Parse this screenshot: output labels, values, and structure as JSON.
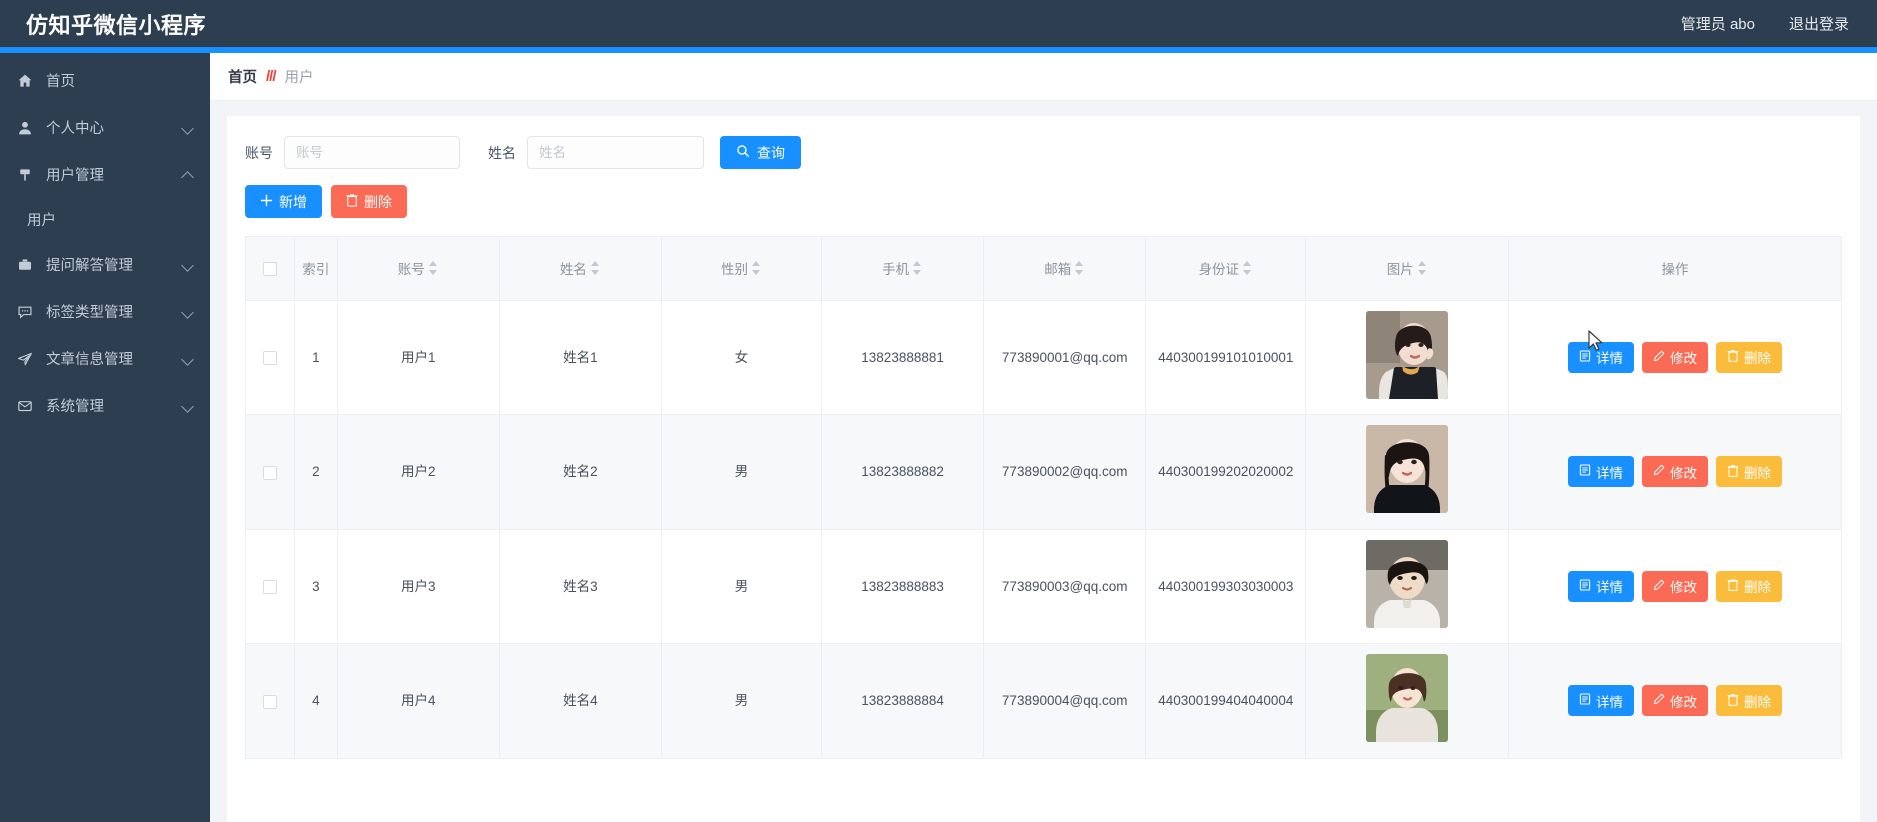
{
  "topbar": {
    "brand": "仿知乎微信小程序",
    "admin_label": "管理员 abo",
    "logout_label": "退出登录"
  },
  "sidebar": {
    "items": [
      {
        "label": "首页",
        "icon": "home-icon",
        "caret": "none",
        "expanded": false
      },
      {
        "label": "个人中心",
        "icon": "user-icon",
        "caret": "down",
        "expanded": false
      },
      {
        "label": "用户管理",
        "icon": "pin-icon",
        "caret": "up",
        "expanded": true
      },
      {
        "label": "提问解答管理",
        "icon": "briefcase-icon",
        "caret": "down",
        "expanded": false
      },
      {
        "label": "标签类型管理",
        "icon": "comment-icon",
        "caret": "down",
        "expanded": false
      },
      {
        "label": "文章信息管理",
        "icon": "send-icon",
        "caret": "down",
        "expanded": false
      },
      {
        "label": "系统管理",
        "icon": "mail-icon",
        "caret": "down",
        "expanded": false
      }
    ],
    "submenu": {
      "parent": "用户管理",
      "items": [
        {
          "label": "用户"
        }
      ]
    }
  },
  "breadcrumb": {
    "home": "首页",
    "separator": "///",
    "current": "用户"
  },
  "search": {
    "account_label": "账号",
    "account_placeholder": "账号",
    "account_value": "",
    "name_label": "姓名",
    "name_placeholder": "姓名",
    "name_value": "",
    "query_button": "查询",
    "query_icon": "search-icon"
  },
  "toolbar": {
    "add_label": "新增",
    "add_icon": "plus-icon",
    "delete_label": "删除",
    "delete_icon": "trash-icon"
  },
  "table": {
    "columns": [
      {
        "key": "checkbox",
        "label": "",
        "sortable": false
      },
      {
        "key": "index",
        "label": "索引",
        "sortable": false
      },
      {
        "key": "account",
        "label": "账号",
        "sortable": true
      },
      {
        "key": "name",
        "label": "姓名",
        "sortable": true
      },
      {
        "key": "gender",
        "label": "性别",
        "sortable": true
      },
      {
        "key": "phone",
        "label": "手机",
        "sortable": true
      },
      {
        "key": "email",
        "label": "邮箱",
        "sortable": true
      },
      {
        "key": "idcard",
        "label": "身份证",
        "sortable": true
      },
      {
        "key": "image",
        "label": "图片",
        "sortable": true
      },
      {
        "key": "ops",
        "label": "操作",
        "sortable": false
      }
    ],
    "rows": [
      {
        "index": "1",
        "account": "用户1",
        "name": "姓名1",
        "gender": "女",
        "phone": "13823888881",
        "email": "773890001@qq.com",
        "idcard": "440300199101010001",
        "image_alt": "avatar-1"
      },
      {
        "index": "2",
        "account": "用户2",
        "name": "姓名2",
        "gender": "男",
        "phone": "13823888882",
        "email": "773890002@qq.com",
        "idcard": "440300199202020002",
        "image_alt": "avatar-2"
      },
      {
        "index": "3",
        "account": "用户3",
        "name": "姓名3",
        "gender": "男",
        "phone": "13823888883",
        "email": "773890003@qq.com",
        "idcard": "440300199303030003",
        "image_alt": "avatar-3"
      },
      {
        "index": "4",
        "account": "用户4",
        "name": "姓名4",
        "gender": "男",
        "phone": "13823888884",
        "email": "773890004@qq.com",
        "idcard": "440300199404040004",
        "image_alt": "avatar-4"
      }
    ],
    "row_ops": {
      "detail_label": "详情",
      "detail_icon": "doc-icon",
      "edit_label": "修改",
      "edit_icon": "pencil-icon",
      "delete_label": "删除",
      "delete_icon": "trash-icon"
    }
  },
  "colors": {
    "topbar_bg": "#2c3e50",
    "accent_blue": "#1890ff",
    "danger_red": "#fa6a54",
    "warning_orange": "#fbbc3c",
    "breadcrumb_sep": "#ef4136",
    "page_bg": "#f2f4f7"
  }
}
